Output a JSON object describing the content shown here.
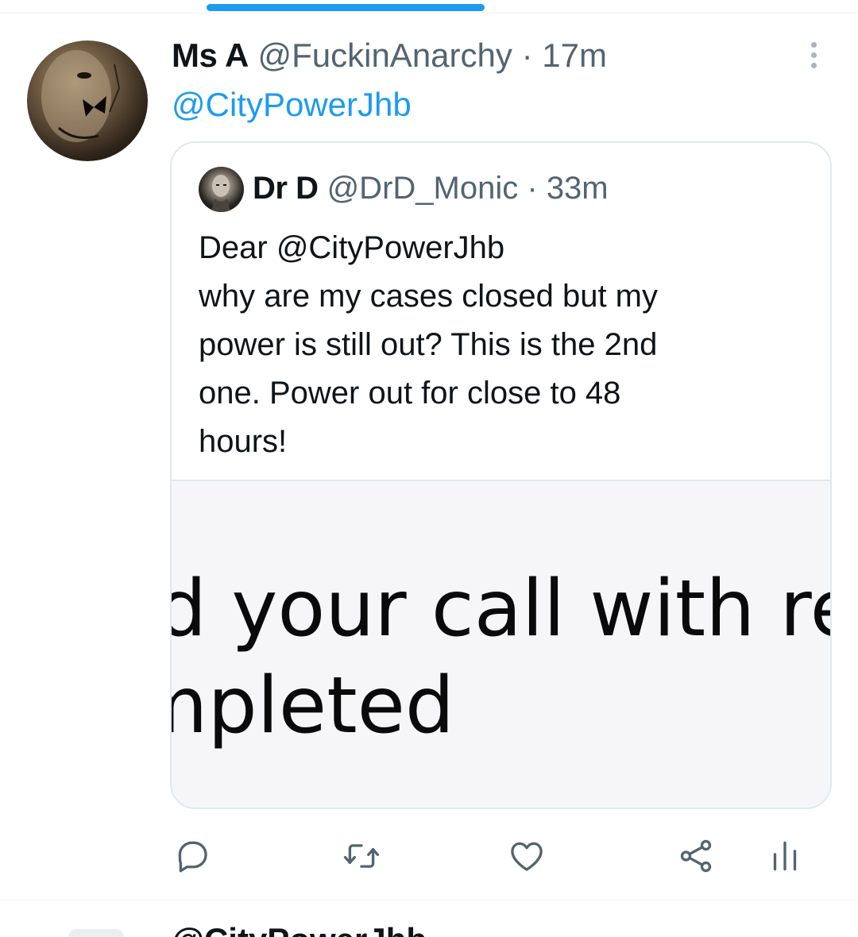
{
  "tweet": {
    "display_name": "Ms A",
    "handle": "@FuckinAnarchy",
    "separator": "·",
    "time": "17m",
    "replying_to": "@CityPowerJhb"
  },
  "quoted": {
    "display_name": "Dr D",
    "handle": "@DrD_Monic",
    "separator": "·",
    "time": "33m",
    "lines": [
      "Dear @CityPowerJhb",
      "why are my cases closed but my",
      "power is still out? This is the 2nd",
      "one. Power out for close to 48",
      "hours!"
    ],
    "image_text": [
      "d your call with ref",
      "mpleted"
    ]
  },
  "next_tweet": {
    "header_partial": "@CityPowerJhb"
  },
  "colors": {
    "accent": "#1d9bf0",
    "muted": "#536471",
    "icon": "#536471",
    "border": "#e1e8ed"
  },
  "icons": [
    "more-icon",
    "reply-icon",
    "retweet-icon",
    "like-icon",
    "share-icon",
    "analytics-icon"
  ]
}
